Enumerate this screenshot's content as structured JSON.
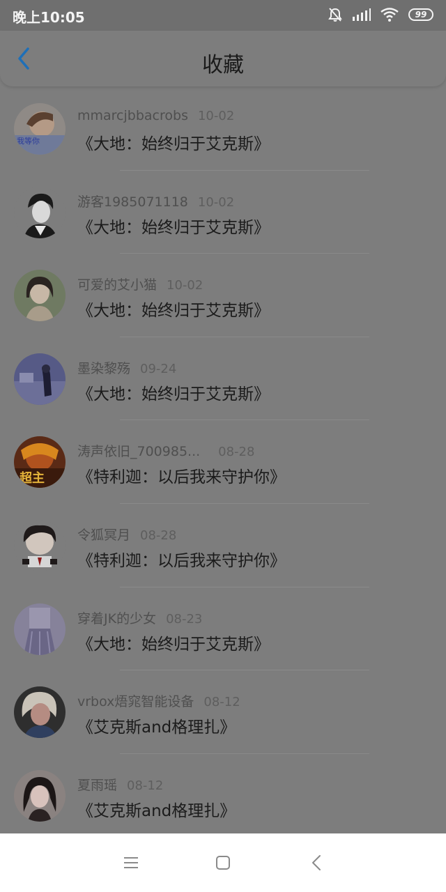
{
  "status_bar": {
    "time": "晚上10:05",
    "battery": "99",
    "icons": [
      "mute-bell-icon",
      "signal-icon",
      "wifi-icon",
      "battery-icon"
    ]
  },
  "header": {
    "title": "收藏",
    "back_icon": "chevron-left-icon"
  },
  "favorites": [
    {
      "user": "mmarcjbbacrobs",
      "date": "10-02",
      "title": "《大地：始终归于艾克斯》"
    },
    {
      "user": "游客1985071118",
      "date": "10-02",
      "title": "《大地：始终归于艾克斯》"
    },
    {
      "user": "可爱的艾小猫",
      "date": "10-02",
      "title": "《大地：始终归于艾克斯》"
    },
    {
      "user": "墨染黎殇",
      "date": "09-24",
      "title": "《大地：始终归于艾克斯》"
    },
    {
      "user": "涛声依旧_700985...",
      "date": "08-28",
      "title": "《特利迦：以后我来守护你》"
    },
    {
      "user": "令狐冥月",
      "date": "08-28",
      "title": "《特利迦：以后我来守护你》"
    },
    {
      "user": "穿着JK的少女",
      "date": "08-23",
      "title": "《大地：始终归于艾克斯》"
    },
    {
      "user": "vrbox焐窕智能设备",
      "date": "08-12",
      "title": "《艾克斯and格理扎》"
    },
    {
      "user": "夏雨瑶",
      "date": "08-12",
      "title": "《艾克斯and格理扎》"
    }
  ],
  "avatar_overlay_texts": {
    "item0": "我等你",
    "item4": "超主"
  },
  "nav_bar": {
    "icons": [
      "menu-icon",
      "home-square-icon",
      "back-triangle-icon"
    ]
  },
  "colors": {
    "accent": "#1e6fb8",
    "overlay": "#7d7d7d",
    "nav_bar": "#ffffff"
  }
}
